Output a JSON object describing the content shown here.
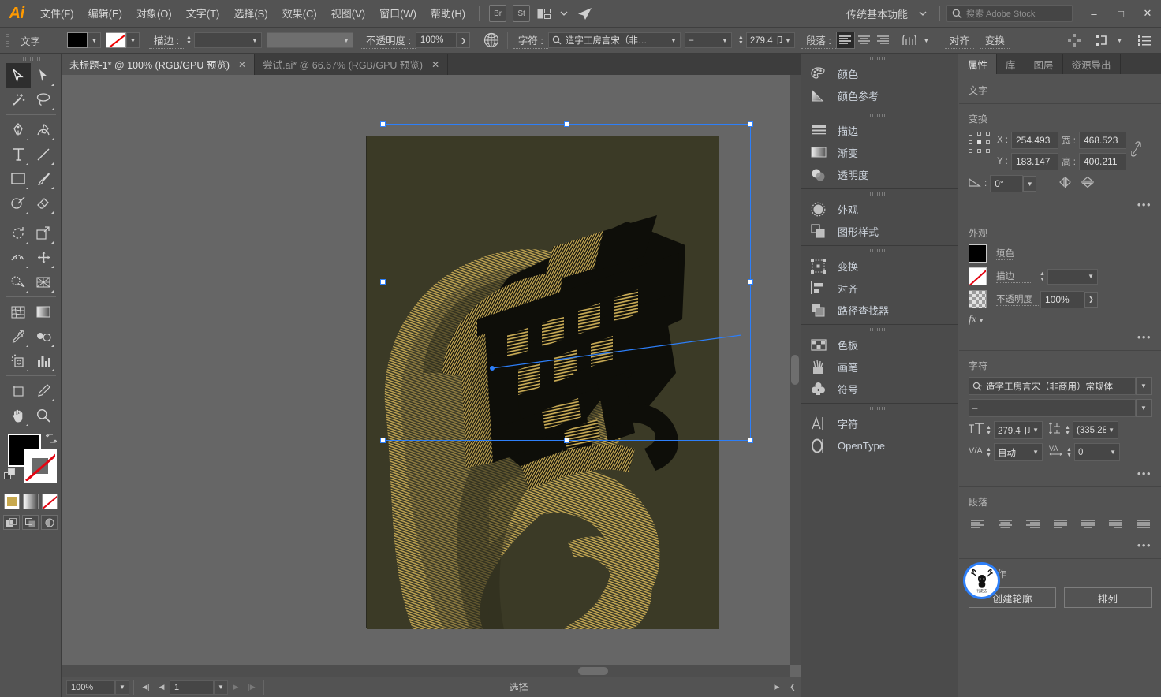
{
  "app": {
    "name": "Adobe Illustrator",
    "logo_text": "Ai"
  },
  "menubar": {
    "items": [
      {
        "label": "文件(F)"
      },
      {
        "label": "编辑(E)"
      },
      {
        "label": "对象(O)"
      },
      {
        "label": "文字(T)"
      },
      {
        "label": "选择(S)"
      },
      {
        "label": "效果(C)"
      },
      {
        "label": "视图(V)"
      },
      {
        "label": "窗口(W)"
      },
      {
        "label": "帮助(H)"
      }
    ],
    "bridge_badge": "Br",
    "stock_badge": "St",
    "workspace": "传统基本功能",
    "search_placeholder": "搜索 Adobe Stock",
    "window_minimize": "–",
    "window_maximize": "□",
    "window_close": "✕"
  },
  "controlbar": {
    "context_label": "文字",
    "fill_color": "#000000",
    "stroke_label": "描边 :",
    "stroke_weight": "",
    "stroke_profile": "",
    "opacity_label": "不透明度 :",
    "opacity_value": "100%",
    "char_label": "字符 :",
    "font_family": "造字工房言宋（非…",
    "font_style": "–",
    "font_size": "279.4 卩",
    "para_label": "段落 :",
    "align_left": "align-left",
    "align_center": "align-center",
    "align_right": "align-right",
    "align_link": "对齐",
    "transform_link": "变换"
  },
  "toolbar": {
    "tools": [
      {
        "name": "selection-tool",
        "active": true
      },
      {
        "name": "direct-selection-tool",
        "active": false
      },
      {
        "name": "magic-wand-tool",
        "active": false
      },
      {
        "name": "lasso-tool",
        "active": false
      },
      {
        "name": "pen-tool",
        "active": false
      },
      {
        "name": "curvature-tool",
        "active": false
      },
      {
        "name": "type-tool",
        "active": false
      },
      {
        "name": "line-segment-tool",
        "active": false
      },
      {
        "name": "rectangle-tool",
        "active": false
      },
      {
        "name": "paintbrush-tool",
        "active": false
      },
      {
        "name": "shaper-tool",
        "active": false
      },
      {
        "name": "eraser-tool",
        "active": false
      },
      {
        "name": "rotate-tool",
        "active": false
      },
      {
        "name": "scale-tool",
        "active": false
      },
      {
        "name": "width-tool",
        "active": false
      },
      {
        "name": "free-transform-tool",
        "active": false
      },
      {
        "name": "shape-builder-tool",
        "active": false
      },
      {
        "name": "perspective-grid-tool",
        "active": false
      },
      {
        "name": "mesh-tool",
        "active": false
      },
      {
        "name": "gradient-tool",
        "active": false
      },
      {
        "name": "eyedropper-tool",
        "active": false
      },
      {
        "name": "blend-tool",
        "active": false
      },
      {
        "name": "symbol-sprayer-tool",
        "active": false
      },
      {
        "name": "column-graph-tool",
        "active": false
      },
      {
        "name": "artboard-tool",
        "active": false
      },
      {
        "name": "slice-tool",
        "active": false
      },
      {
        "name": "hand-tool",
        "active": false
      },
      {
        "name": "zoom-tool",
        "active": false
      }
    ],
    "fill_color": "#000000",
    "stroke_color": "none",
    "color_mode": "#c8a94f"
  },
  "tabs": [
    {
      "label": "未标题-1* @ 100% (RGB/GPU 预览)",
      "active": true,
      "close": "✕"
    },
    {
      "label": "尝试.ai* @ 66.67% (RGB/GPU 预览)",
      "active": false,
      "close": "✕"
    }
  ],
  "artwork": {
    "character": "鹿",
    "background_color": "#3b3a26",
    "line_color": "#c9ab55",
    "shadow_color": "#0d0d08",
    "description": "3D extruded Chinese character 鹿 with gold line-blend ribbon"
  },
  "statusbar": {
    "zoom": "100%",
    "page": "1",
    "status_text": "选择"
  },
  "dock": {
    "groups": [
      {
        "items": [
          {
            "label": "颜色",
            "icon": "color-palette-icon"
          },
          {
            "label": "颜色参考",
            "icon": "color-guide-icon"
          }
        ]
      },
      {
        "items": [
          {
            "label": "描边",
            "icon": "stroke-icon"
          },
          {
            "label": "渐变",
            "icon": "gradient-icon"
          },
          {
            "label": "透明度",
            "icon": "transparency-icon"
          }
        ]
      },
      {
        "items": [
          {
            "label": "外观",
            "icon": "appearance-icon"
          },
          {
            "label": "图形样式",
            "icon": "graphic-styles-icon"
          }
        ]
      },
      {
        "items": [
          {
            "label": "变换",
            "icon": "transform-icon"
          },
          {
            "label": "对齐",
            "icon": "align-icon"
          },
          {
            "label": "路径查找器",
            "icon": "pathfinder-icon"
          }
        ]
      },
      {
        "items": [
          {
            "label": "色板",
            "icon": "swatches-icon"
          },
          {
            "label": "画笔",
            "icon": "brushes-icon"
          },
          {
            "label": "符号",
            "icon": "symbols-icon"
          }
        ]
      },
      {
        "items": [
          {
            "label": "字符",
            "icon": "character-icon"
          },
          {
            "label": "OpenType",
            "icon": "opentype-icon"
          }
        ]
      }
    ]
  },
  "properties": {
    "tabs": [
      {
        "label": "属性",
        "active": true
      },
      {
        "label": "库",
        "active": false
      },
      {
        "label": "图层",
        "active": false
      },
      {
        "label": "资源导出",
        "active": false
      }
    ],
    "object_type": "文字",
    "transform": {
      "title": "变换",
      "x_label": "X :",
      "x_value": "254.493",
      "y_label": "Y :",
      "y_value": "183.147",
      "w_label": "宽 :",
      "w_value": "468.523",
      "h_label": "高 :",
      "h_value": "400.211",
      "angle_value": "0°",
      "more": "•••"
    },
    "appearance": {
      "title": "外观",
      "fill_label": "填色",
      "fill_color": "#000000",
      "stroke_label": "描边",
      "stroke_value": "",
      "opacity_label": "不透明度",
      "opacity_value": "100%",
      "fx_label": "fx",
      "more": "•••"
    },
    "character": {
      "title": "字符",
      "font_family": "造字工房言宋（非商用）常规体",
      "font_style": "–",
      "font_size": "279.4 卩",
      "leading": "(335.28",
      "kerning": "自动",
      "tracking": "0",
      "more": "•••"
    },
    "paragraph": {
      "title": "段落",
      "buttons": [
        "align-left",
        "align-center",
        "align-right",
        "justify-last-left",
        "justify-last-center",
        "justify-last-right",
        "justify-all"
      ],
      "more": "•••"
    },
    "quick_actions": {
      "title": "快速操作",
      "buttons": [
        {
          "label": "创建轮廓"
        },
        {
          "label": "排列"
        }
      ]
    }
  },
  "colors": {
    "chrome_bg": "#535353",
    "panel_bg": "#4b4b4b",
    "canvas_bg": "#666666",
    "accent_blue": "#2d7ff9",
    "brand_orange": "#ff9a00",
    "link_blue": "#ccd3dc"
  }
}
